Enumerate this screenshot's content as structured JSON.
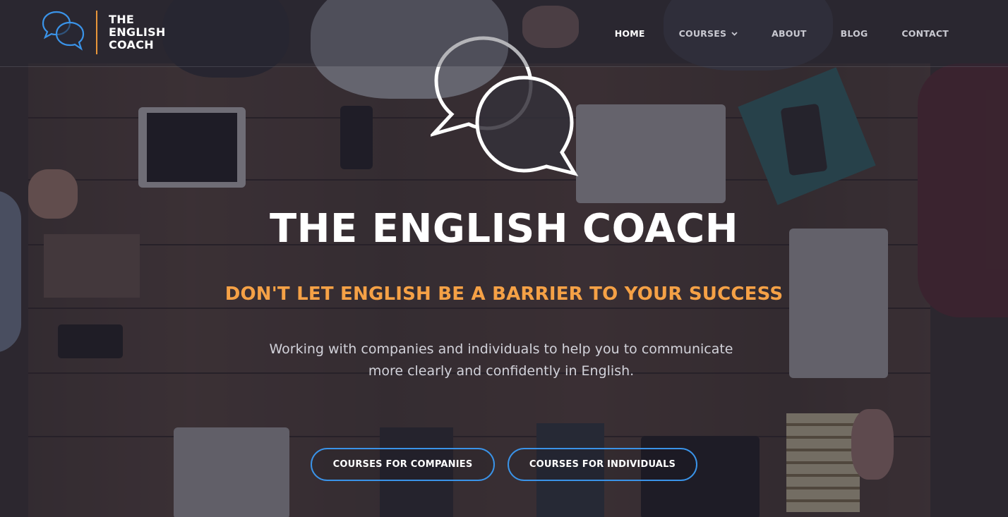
{
  "brand": {
    "name_lines": [
      "THE",
      "ENGLISH",
      "COACH"
    ],
    "accent_color": "#e8963a",
    "icon_color": "#3a93e8"
  },
  "nav": {
    "items": [
      {
        "label": "HOME",
        "active": true
      },
      {
        "label": "COURSES",
        "has_dropdown": true
      },
      {
        "label": "ABOUT"
      },
      {
        "label": "BLOG"
      },
      {
        "label": "CONTACT"
      }
    ]
  },
  "hero": {
    "title": "THE ENGLISH COACH",
    "subtitle": "DON'T LET ENGLISH BE A BARRIER TO YOUR SUCCESS",
    "description": "Working with companies and individuals to help you to communicate more clearly and confidently in English.",
    "subtitle_color": "#f5a146",
    "buttons": {
      "companies": "COURSES FOR COMPANIES",
      "individuals": "COURSES FOR INDIVIDUALS"
    },
    "button_border_color": "#3a93e8"
  }
}
